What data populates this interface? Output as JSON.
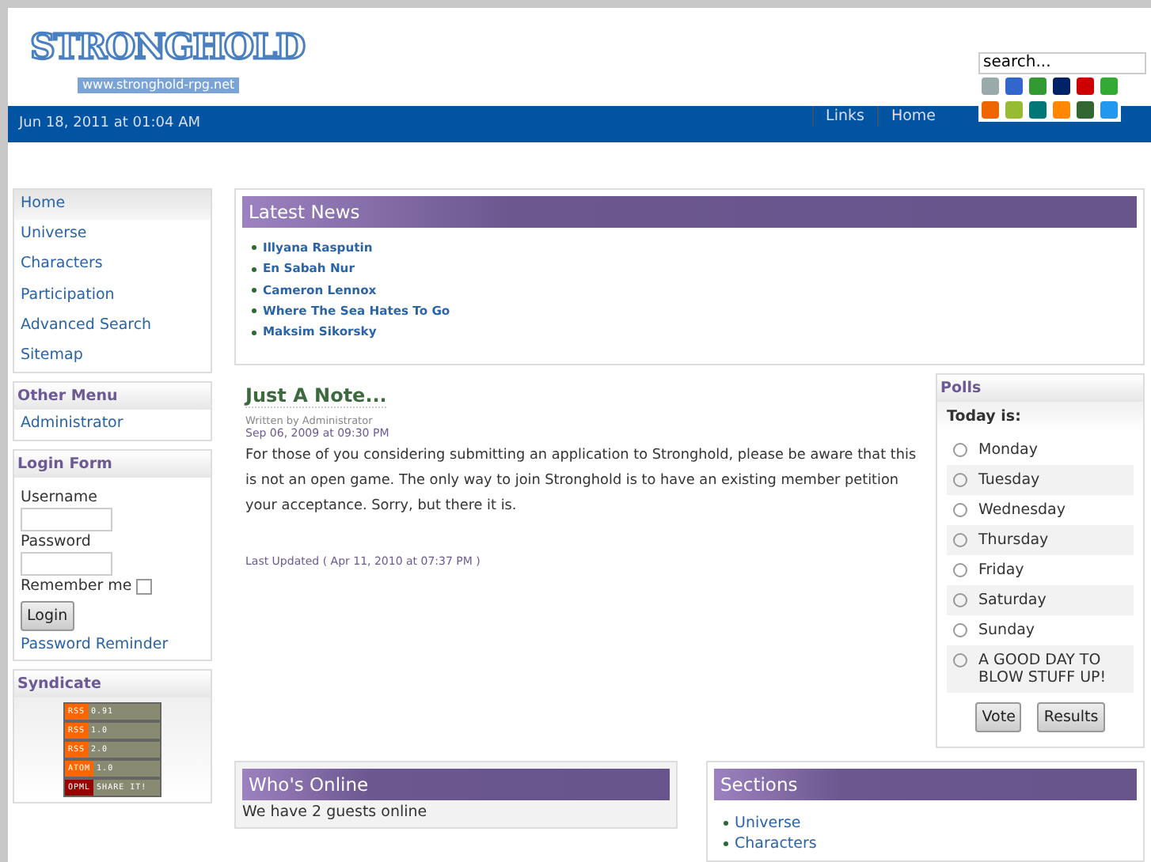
{
  "header": {
    "logo": "STRONGHOLD",
    "logo_url": "www.stronghold-rpg.net",
    "search": {
      "placeholder": "search..."
    }
  },
  "topbar": {
    "date": "Jun 18, 2011 at 01:04 AM",
    "links": [
      "Links",
      "Home"
    ]
  },
  "main_menu": [
    {
      "label": "Home",
      "selected": true
    },
    {
      "label": "Universe",
      "selected": false
    },
    {
      "label": "Characters",
      "selected": false
    },
    {
      "label": "Participation",
      "selected": false
    },
    {
      "label": "Advanced Search",
      "selected": false
    },
    {
      "label": "Sitemap",
      "selected": false
    }
  ],
  "other_menu": {
    "title": "Other Menu",
    "items": [
      "Administrator"
    ]
  },
  "login": {
    "title": "Login Form",
    "username_label": "Username",
    "password_label": "Password",
    "remember_label": "Remember me",
    "remember_checked": false,
    "button": "Login",
    "reminder": "Password Reminder"
  },
  "syndicate": {
    "title": "Syndicate",
    "feeds": [
      {
        "label": "RSS",
        "version": "0.91",
        "color": "#ff6600"
      },
      {
        "label": "RSS",
        "version": "1.0",
        "color": "#ff6600"
      },
      {
        "label": "RSS",
        "version": "2.0",
        "color": "#ff6600"
      },
      {
        "label": "ATOM",
        "version": "1.0",
        "color": "#ff6600"
      },
      {
        "label": "OPML",
        "version": "SHARE IT!",
        "color": "#990000"
      }
    ]
  },
  "latest_news": {
    "title": "Latest News",
    "items": [
      "Illyana Rasputin",
      "En Sabah Nur",
      "Cameron Lennox",
      "Where The Sea Hates To Go",
      "Maksim Sikorsky"
    ]
  },
  "article": {
    "title": "Just A Note...",
    "author": "Written by Administrator",
    "date": "Sep 06, 2009 at 09:30 PM",
    "body": "For those of you considering submitting an application to Stronghold, please be aware that this is not an open game. The only way to join Stronghold is to have an existing member petition your acceptance. Sorry, but there it is.",
    "updated": "Last Updated ( Apr 11, 2010 at 07:37 PM )"
  },
  "polls": {
    "title": "Polls",
    "question": "Today is:",
    "options": [
      {
        "label": "Monday",
        "checked": false
      },
      {
        "label": "Tuesday",
        "checked": false
      },
      {
        "label": "Wednesday",
        "checked": false
      },
      {
        "label": "Thursday",
        "checked": false
      },
      {
        "label": "Friday",
        "checked": false
      },
      {
        "label": "Saturday",
        "checked": false
      },
      {
        "label": "Sunday",
        "checked": false
      },
      {
        "label": "A GOOD DAY TO BLOW STUFF UP!",
        "checked": false
      }
    ],
    "buttons": [
      "Vote",
      "Results"
    ]
  },
  "whos_online": {
    "title": "Who's Online",
    "text": "We have 2 guests online"
  },
  "sections": {
    "title": "Sections",
    "items": [
      "Universe",
      "Characters"
    ]
  }
}
